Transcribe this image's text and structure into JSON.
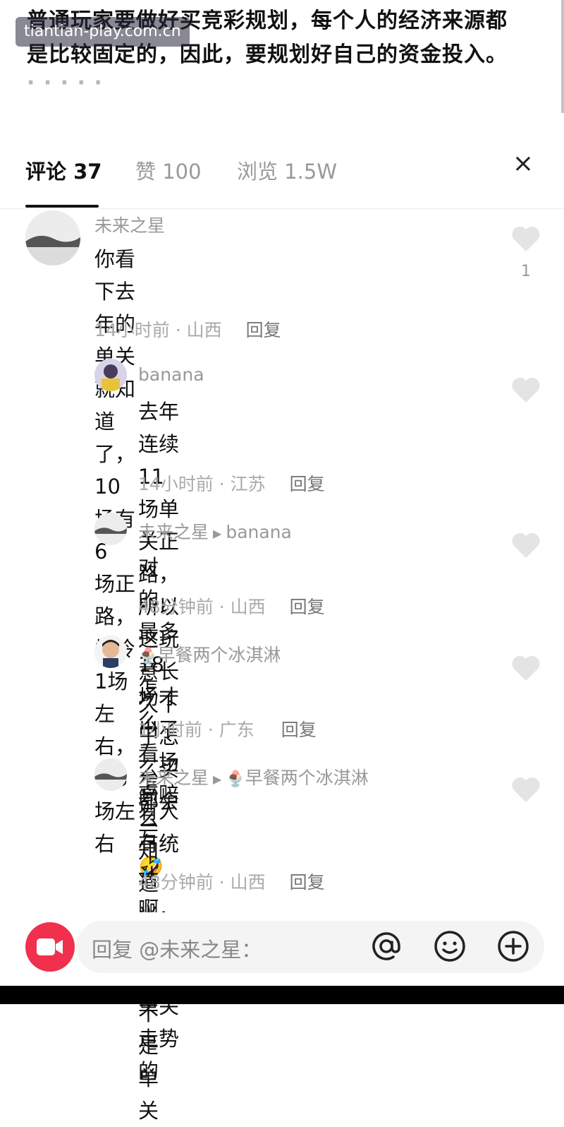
{
  "article": {
    "line1": "普通玩家要做好买竞彩规划，每个人的经济来源都",
    "line2": "是比较固定的，因此，要规划好自己的资金投入。",
    "line3": "·  ·  ·  ·  ·"
  },
  "watermark": "tiantian-play.com.cn",
  "tabs": [
    {
      "label": "评论 37",
      "active": true
    },
    {
      "label": "赞 100",
      "active": false
    },
    {
      "label": "浏览 1.5W",
      "active": false
    }
  ],
  "close_glyph": "×",
  "comments": [
    {
      "username": "未来之星",
      "text_lines": [
        "你看下去年的单关就知道了，10场有6",
        "场正路，爆冷1场左右，平3场左右"
      ],
      "time": "14小时前 · 山西",
      "reply_label": "回复",
      "likes": "1"
    },
    {
      "username": "banana",
      "text_lines": [
        "去年连续11场单关正路，所以这玩",
        "意长久下了怎么买都会亏"
      ],
      "emoji": "🤣",
      "time": "14小时前 · 江苏",
      "reply_label": "回复"
    },
    {
      "username": "未来之星",
      "reply_to": "banana",
      "text_lines": [
        "对的，最多18场才出了一场高赔"
      ],
      "time": "48分钟前 · 山西",
      "reply_label": "回复"
    },
    {
      "username": "早餐两个冰淇淋",
      "text_lines": [
        "怎么看 怎么知道当时 是不是单关"
      ],
      "time": "1小时前 · 广东",
      "reply_label": "回复"
    },
    {
      "username": "未来之星",
      "reply_to": "早餐两个冰淇淋",
      "text_lines": [
        "有人有统计啊，一直分析单关走势",
        "的"
      ],
      "time": "48分钟前 · 山西",
      "reply_label": "回复"
    }
  ],
  "reply_input": {
    "placeholder": "回复 @未来之星："
  },
  "icons": [
    "video-record-icon",
    "at-icon",
    "emoji-icon",
    "add-icon",
    "heart-icon",
    "close-icon"
  ],
  "colors": {
    "record": "#f0304c",
    "muted": "#999999",
    "text": "#111111"
  }
}
